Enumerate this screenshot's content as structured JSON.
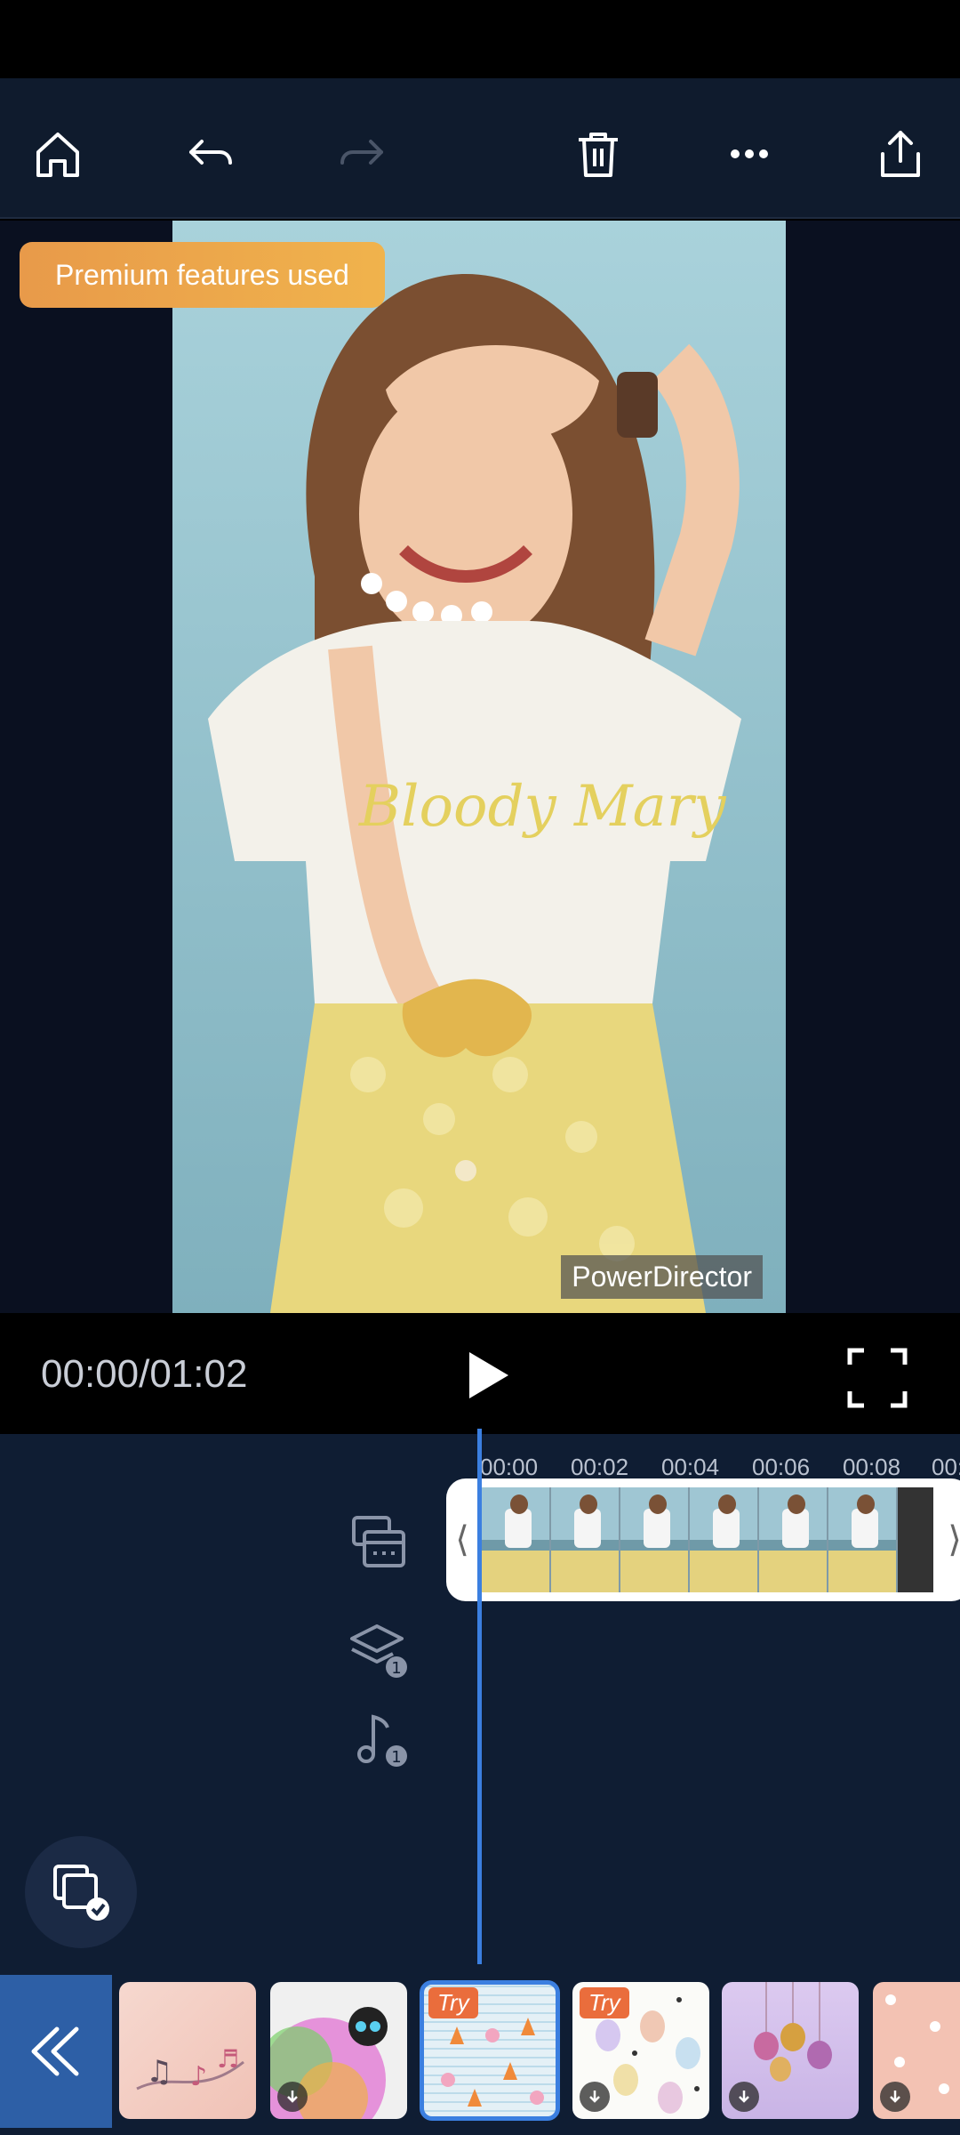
{
  "toolbar": {
    "home": "home-icon",
    "undo": "undo-icon",
    "redo": "redo-icon",
    "delete": "trash-icon",
    "more": "more-icon",
    "share": "share-icon"
  },
  "preview": {
    "premium_badge": "Premium features used",
    "watermark": "PowerDirector",
    "shirt_text": "Bloody Mary"
  },
  "controls": {
    "timecode": "00:00/01:02"
  },
  "timeline": {
    "ticks": [
      "00:00",
      "00:02",
      "00:04",
      "00:06",
      "00:08",
      "00:"
    ],
    "overlay_count": "1",
    "audio_count": "1"
  },
  "effects_strip": {
    "items": [
      {
        "name": "music-notes-theme",
        "badge": ""
      },
      {
        "name": "robot-gradient-theme",
        "badge": ""
      },
      {
        "name": "carrot-bunny-theme",
        "badge": "Try"
      },
      {
        "name": "easter-eggs-theme",
        "badge": "Try"
      },
      {
        "name": "easter-ornaments-theme",
        "badge": ""
      },
      {
        "name": "flower-peach-theme",
        "badge": ""
      }
    ]
  },
  "colors": {
    "toolbar_bg": "#0f1b2d",
    "accent": "#3b7fe0",
    "premium": "#f0b34c",
    "try_badge": "#ea6d3c"
  }
}
